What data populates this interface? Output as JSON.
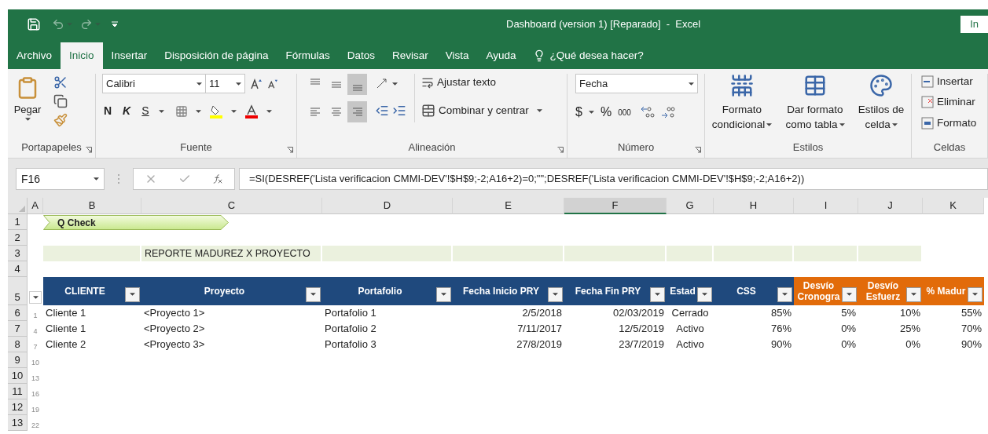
{
  "title_bar": {
    "title": "Dashboard (version 1) [Reparado]  -  Excel",
    "account_button": "In"
  },
  "menu_tabs": [
    {
      "label": "Archivo",
      "selected": false
    },
    {
      "label": "Inicio",
      "selected": true
    },
    {
      "label": "Insertar",
      "selected": false
    },
    {
      "label": "Disposición de página",
      "selected": false
    },
    {
      "label": "Fórmulas",
      "selected": false
    },
    {
      "label": "Datos",
      "selected": false
    },
    {
      "label": "Revisar",
      "selected": false
    },
    {
      "label": "Vista",
      "selected": false
    },
    {
      "label": "Ayuda",
      "selected": false
    }
  ],
  "tell_me": "¿Qué desea hacer?",
  "ribbon": {
    "clipboard": {
      "label": "Portapapeles",
      "paste": "Pegar"
    },
    "font": {
      "label": "Fuente",
      "font_name": "Calibri",
      "font_size": "11",
      "bold": "N",
      "italic": "K",
      "underline": "S"
    },
    "alignment": {
      "label": "Alineación",
      "vertical": [
        {
          "kind": "top",
          "selected": false
        },
        {
          "kind": "middle",
          "selected": false
        },
        {
          "kind": "bottom",
          "selected": true
        }
      ],
      "horizontal": [
        {
          "kind": "left",
          "selected": false
        },
        {
          "kind": "center",
          "selected": false
        },
        {
          "kind": "right",
          "selected": true
        }
      ],
      "wrap": "Ajustar texto",
      "merge": "Combinar y centrar"
    },
    "number": {
      "label": "Número",
      "format": "Fecha",
      "currency": "$",
      "percent": "%",
      "thousands": "000"
    },
    "styles": {
      "label": "Estilos",
      "items": [
        {
          "kind": "conditional",
          "lines": [
            "Formato",
            "condicional"
          ]
        },
        {
          "kind": "table",
          "lines": [
            "Dar formato",
            "como tabla"
          ]
        },
        {
          "kind": "cell",
          "lines": [
            "Estilos de",
            "celda"
          ]
        }
      ]
    },
    "cells": {
      "label": "Celdas",
      "items": [
        {
          "kind": "insert",
          "label": "Insertar"
        },
        {
          "kind": "delete",
          "label": "Eliminar"
        },
        {
          "kind": "format",
          "label": "Formato"
        }
      ]
    }
  },
  "formula_bar": {
    "name_box": "F16",
    "formula": "=SI(DESREF('Lista verificacion CMMI-DEV'!$H$9;-2;A16+2)=0;\"\";DESREF('Lista verificacion CMMI-DEV'!$H$9;-2;A16+2))"
  },
  "sheet": {
    "columns": [
      {
        "label": "A",
        "selected": false
      },
      {
        "label": "B",
        "selected": false
      },
      {
        "label": "C",
        "selected": false
      },
      {
        "label": "D",
        "selected": false
      },
      {
        "label": "E",
        "selected": false
      },
      {
        "label": "F",
        "selected": true
      },
      {
        "label": "G",
        "selected": false
      },
      {
        "label": "H",
        "selected": false
      },
      {
        "label": "I",
        "selected": false
      },
      {
        "label": "J",
        "selected": false
      },
      {
        "label": "K",
        "selected": false
      }
    ],
    "row_numbers": [
      "1",
      "2",
      "3",
      "4",
      "5",
      "6",
      "7",
      "8",
      "9",
      "10",
      "11",
      "12",
      "13"
    ],
    "column_a_values": [
      "1",
      "4",
      "7",
      "10",
      "13",
      "16",
      "19",
      "22"
    ],
    "banner": "Q Check",
    "report_title": "REPORTE MADUREZ X PROYECTO",
    "table": {
      "columns": [
        {
          "lines": [
            "CLIENTE"
          ],
          "color": "#1f497d"
        },
        {
          "lines": [
            "Proyecto"
          ],
          "color": "#1f497d"
        },
        {
          "lines": [
            "Portafolio"
          ],
          "color": "#1f497d"
        },
        {
          "lines": [
            "Fecha Inicio PRY"
          ],
          "color": "#1f497d"
        },
        {
          "lines": [
            "Fecha Fin PRY"
          ],
          "color": "#1f497d"
        },
        {
          "lines": [
            "Estad"
          ],
          "color": "#1f497d"
        },
        {
          "lines": [
            "CSS"
          ],
          "color": "#1f497d"
        },
        {
          "lines": [
            "Desvío",
            "Cronogra"
          ],
          "color": "#e26b0a"
        },
        {
          "lines": [
            "Desvío",
            "Esfuerz"
          ],
          "color": "#e26b0a"
        },
        {
          "lines": [
            "% Madur"
          ],
          "color": "#e26b0a"
        }
      ],
      "rows": [
        [
          "Cliente 1",
          "<Proyecto 1>",
          "Portafolio 1",
          "2/5/2018",
          "02/03/2019",
          "Cerrado",
          "85%",
          "5%",
          "10%",
          "55%"
        ],
        [
          "Cliente 1",
          "<Proyecto 2>",
          "Portafolio 2",
          "7/11/2017",
          "12/5/2019",
          "Activo",
          "76%",
          "0%",
          "25%",
          "70%"
        ],
        [
          "Cliente 2",
          "<Proyecto 3>",
          "Portafolio 3",
          "27/8/2019",
          "23/7/2019",
          "Activo",
          "90%",
          "0%",
          "0%",
          "90%"
        ]
      ]
    }
  }
}
